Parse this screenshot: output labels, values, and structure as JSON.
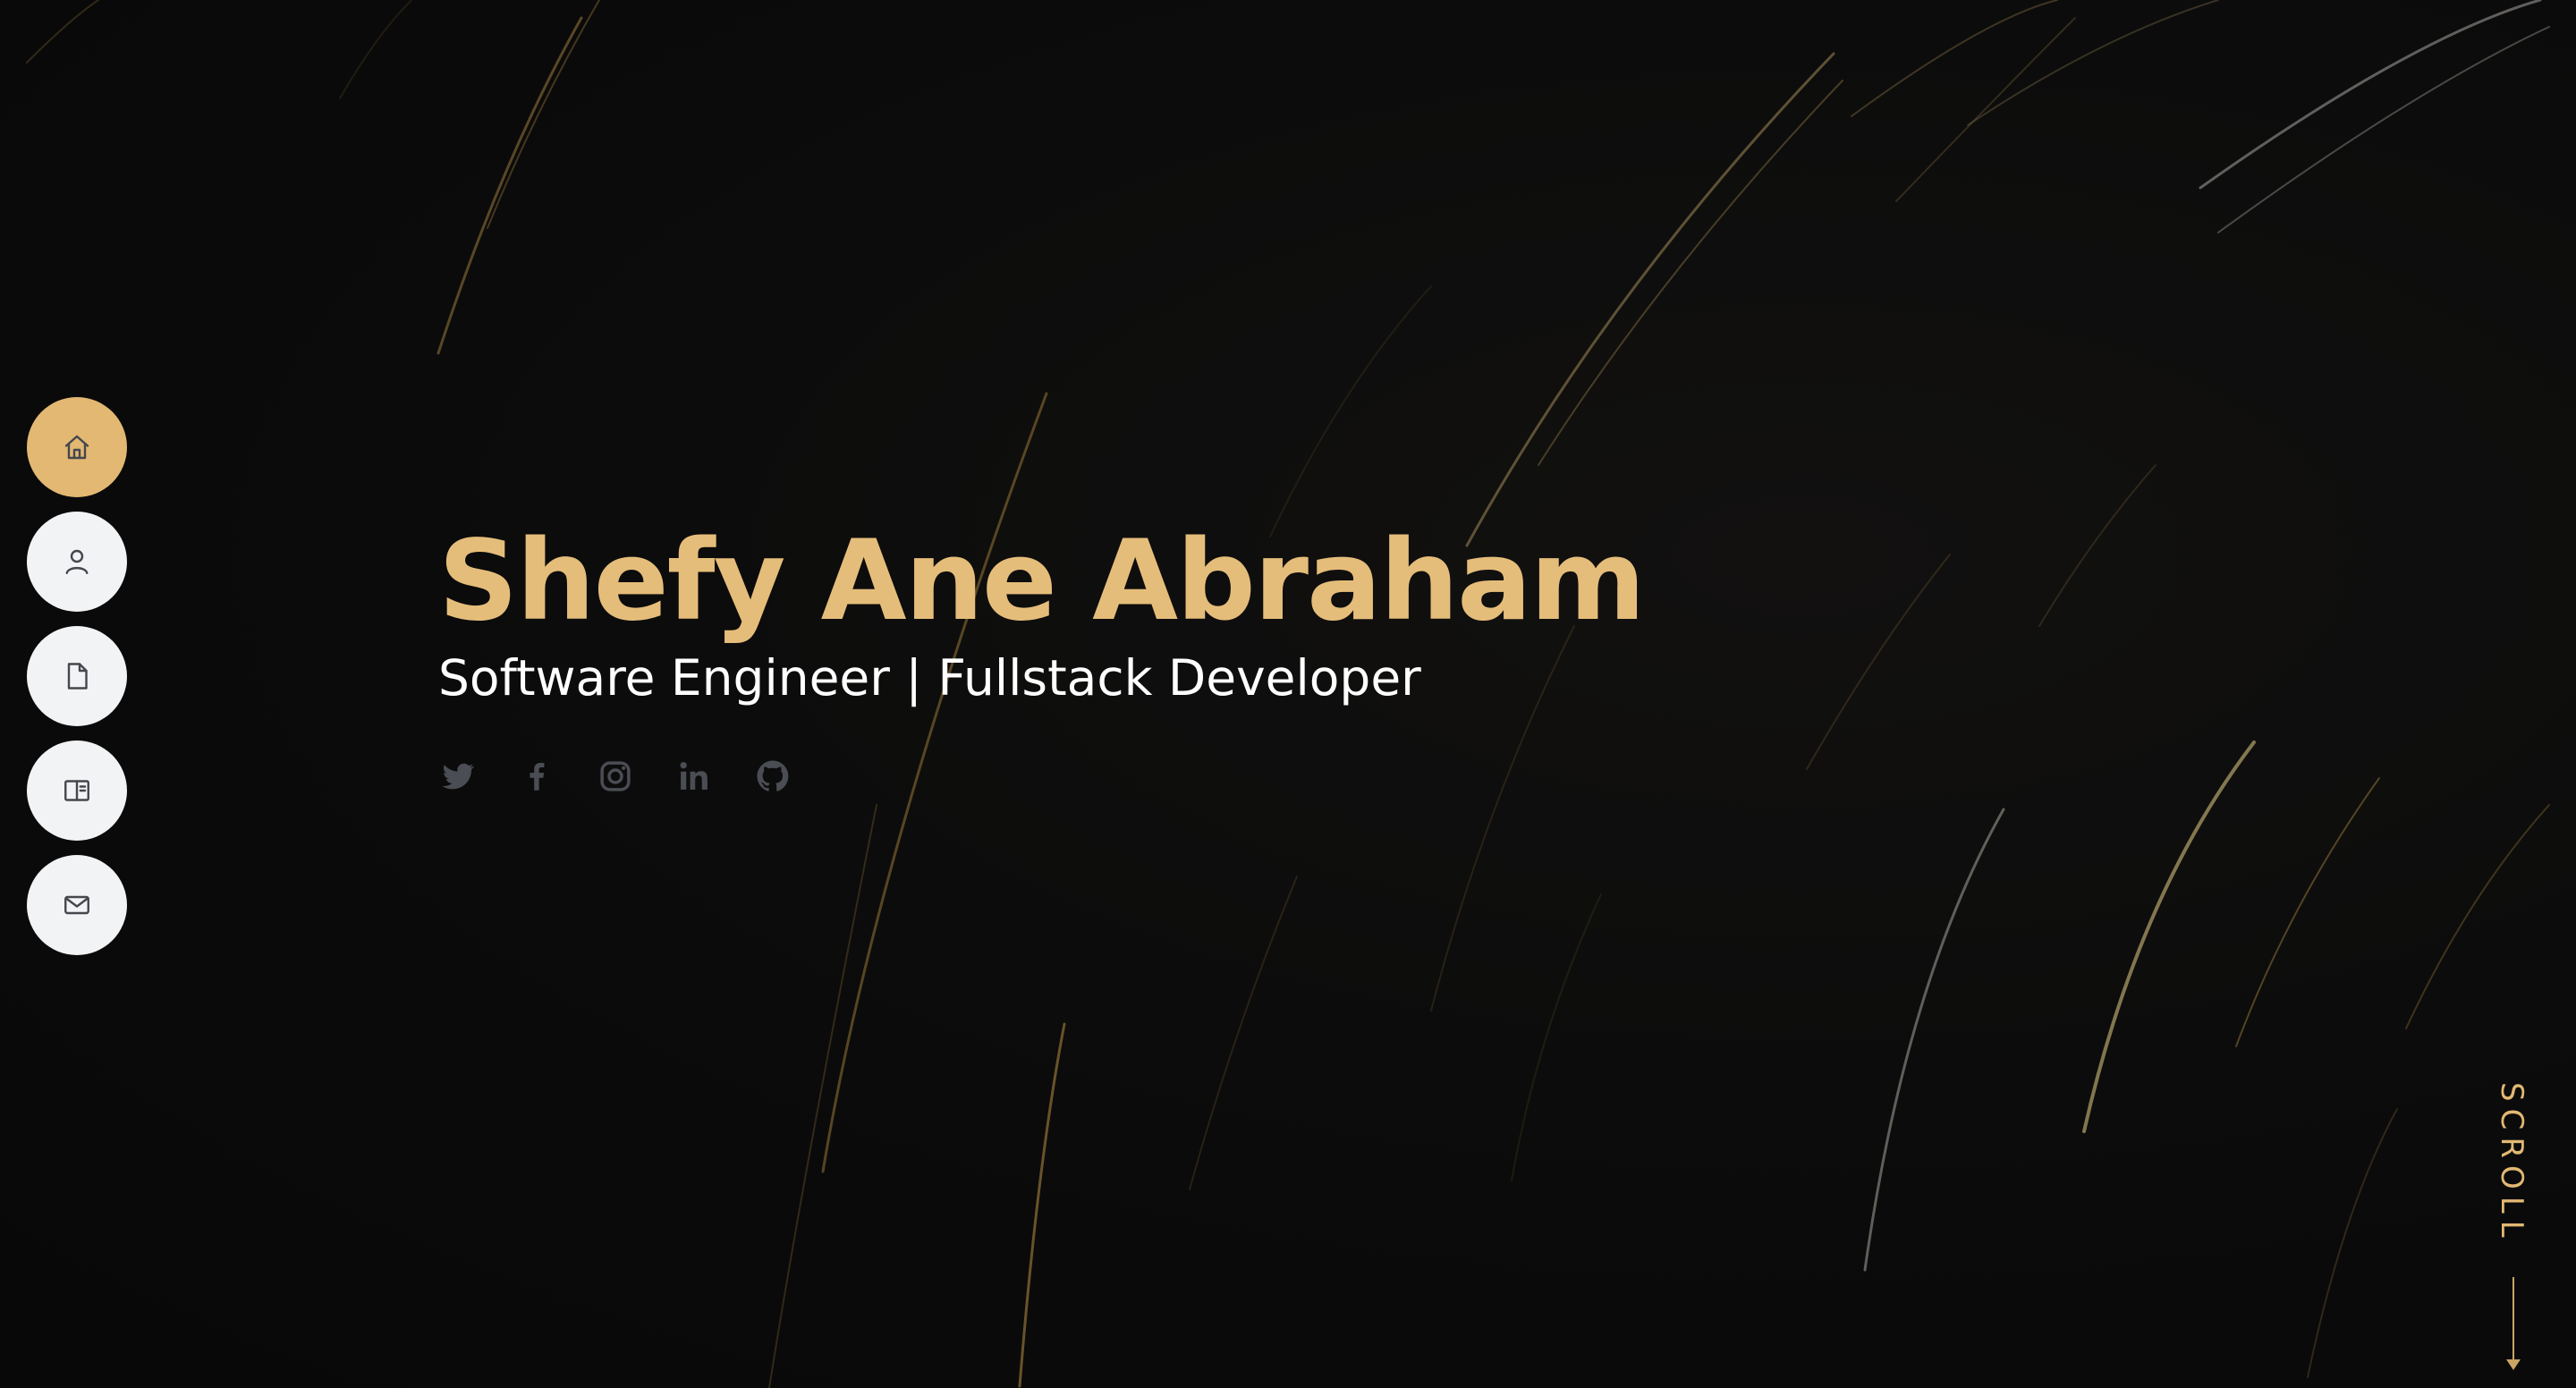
{
  "hero": {
    "name": "Shefy Ane Abraham",
    "role": "Software Engineer | Fullstack Developer"
  },
  "nav": {
    "items": [
      {
        "icon": "home-icon",
        "active": true
      },
      {
        "icon": "user-icon",
        "active": false
      },
      {
        "icon": "document-icon",
        "active": false
      },
      {
        "icon": "book-icon",
        "active": false
      },
      {
        "icon": "mail-icon",
        "active": false
      }
    ]
  },
  "socials": [
    {
      "icon": "twitter-icon"
    },
    {
      "icon": "facebook-icon"
    },
    {
      "icon": "instagram-icon"
    },
    {
      "icon": "linkedin-icon"
    },
    {
      "icon": "github-icon"
    }
  ],
  "scroll": {
    "label": "SCROLL"
  },
  "colors": {
    "accent": "#e2b872",
    "name": "#e5bd7a",
    "background": "#0a0a0a",
    "nav_button": "#f2f3f5",
    "social_icon": "#4a4d53"
  }
}
